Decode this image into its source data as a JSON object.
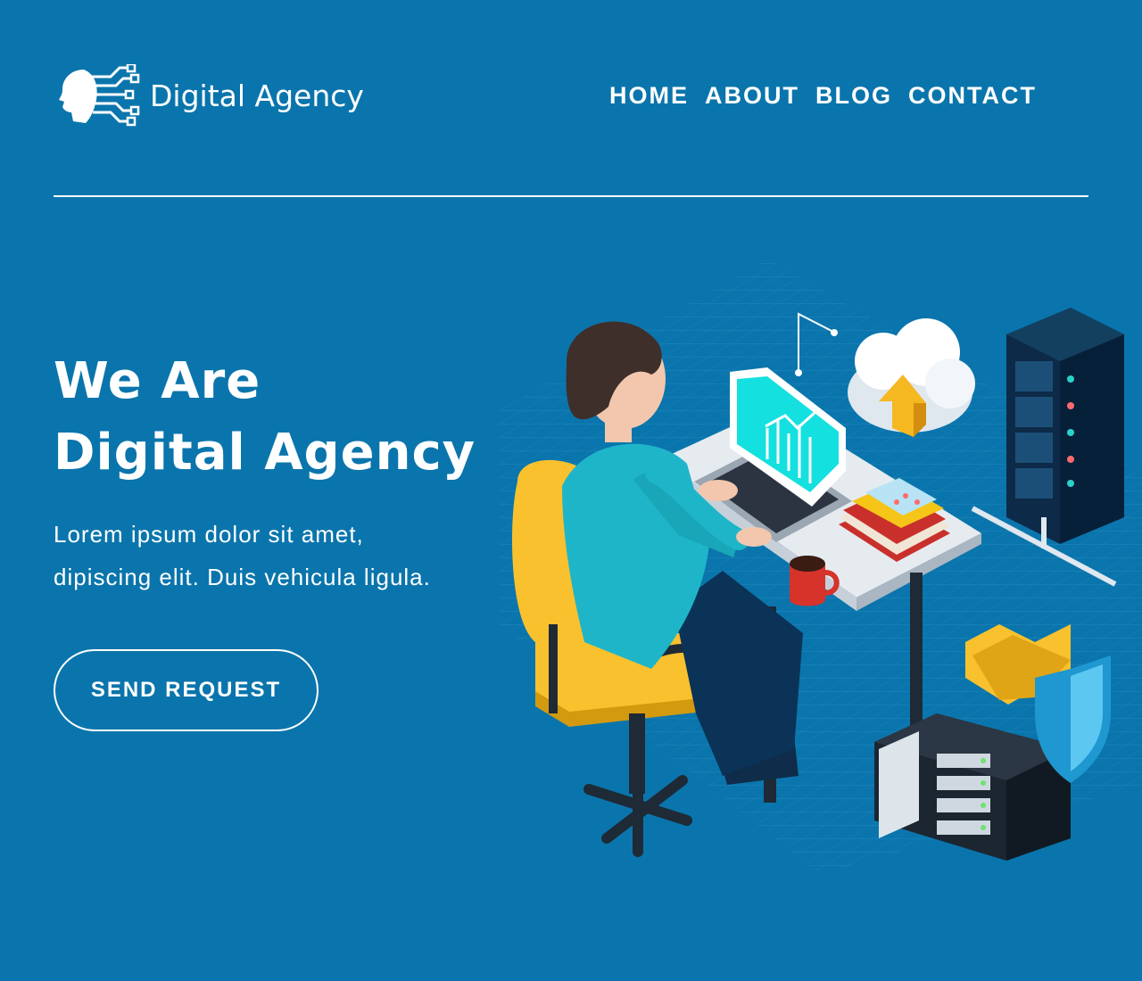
{
  "brand": {
    "name": "Digital Agency",
    "logo_icon": "ai-head-circuit-icon"
  },
  "nav": {
    "items": [
      {
        "label": "HOME"
      },
      {
        "label": "ABOUT"
      },
      {
        "label": "BLOG"
      },
      {
        "label": "CONTACT"
      }
    ]
  },
  "hero": {
    "title_line1": "We Are",
    "title_line2": "Digital Agency",
    "text_line1": "Lorem ipsum dolor sit amet,",
    "text_line2": "dipiscing elit. Duis vehicula ligula.",
    "cta_label": "SEND REQUEST"
  },
  "colors": {
    "background": "#0a75ac",
    "text": "#ffffff",
    "chair": "#f9c12e",
    "shirt": "#1fb5c9",
    "screen": "#15e0e0"
  }
}
